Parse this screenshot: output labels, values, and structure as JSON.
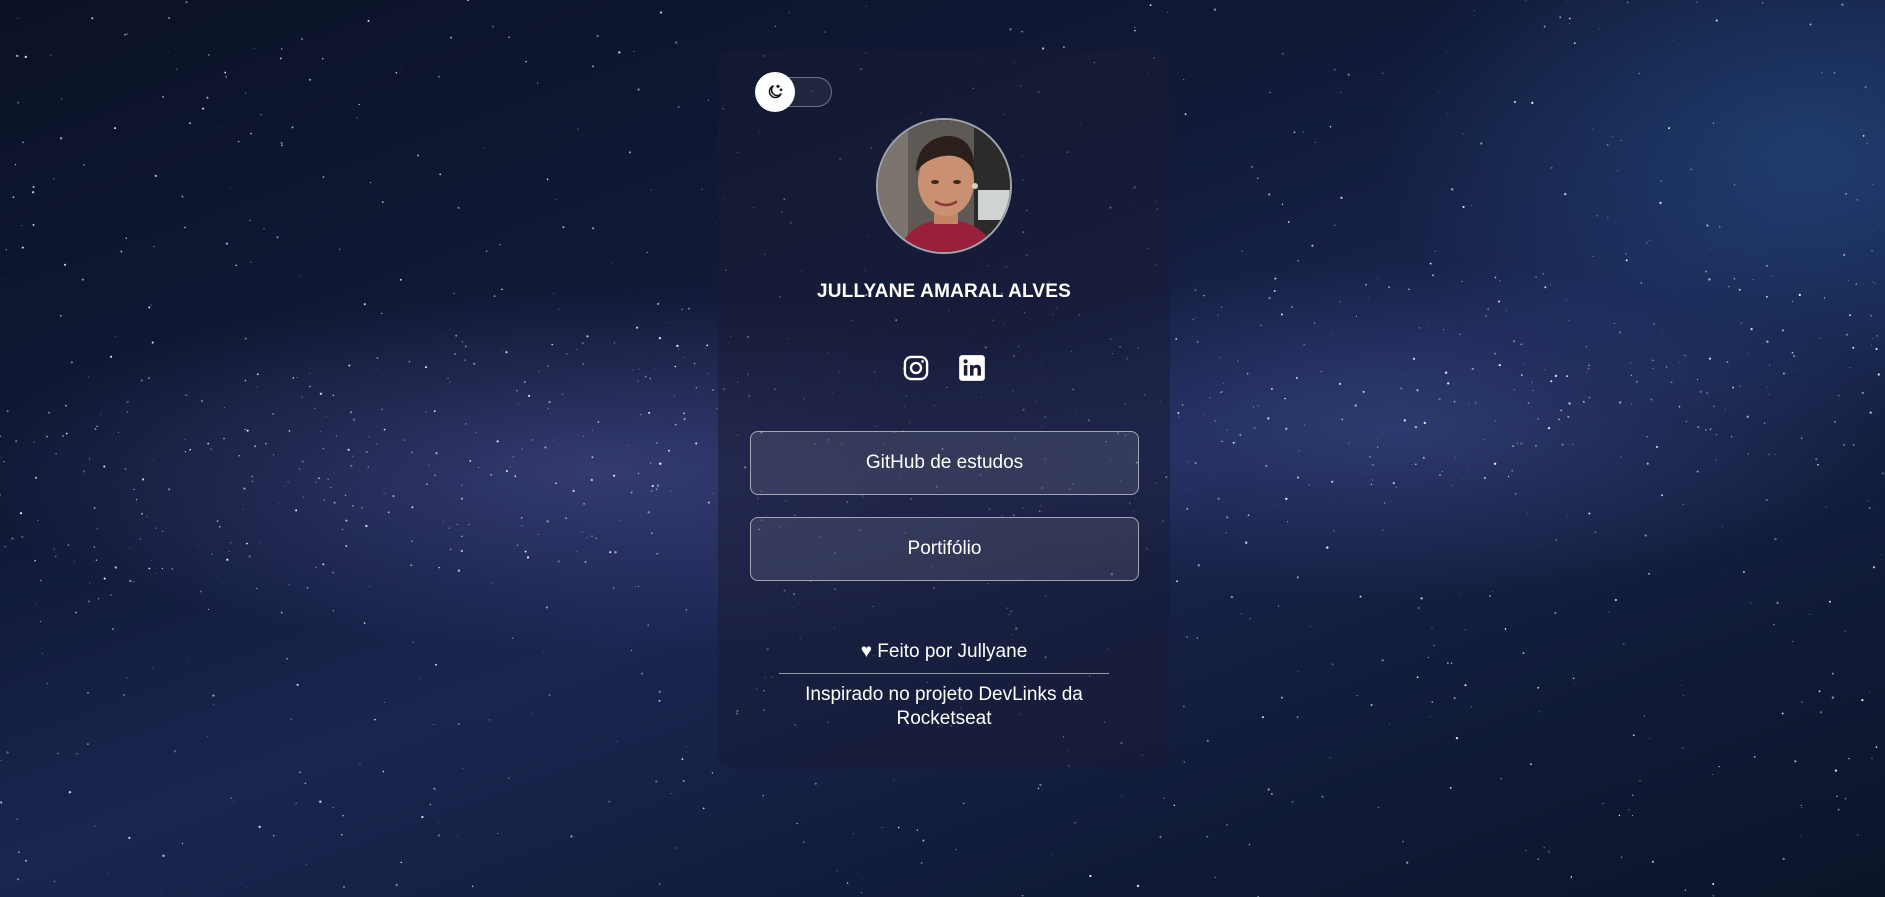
{
  "profile": {
    "name": "JULLYANE AMARAL ALVES",
    "avatar_alt": "Jullyane Amaral Alves"
  },
  "theme_toggle": {
    "icon": "moon-icon",
    "state": "dark"
  },
  "socials": [
    {
      "name": "instagram",
      "icon": "instagram-icon"
    },
    {
      "name": "linkedin",
      "icon": "linkedin-icon"
    }
  ],
  "links": [
    {
      "label": "GitHub de estudos"
    },
    {
      "label": "Portifólio"
    }
  ],
  "footer": {
    "made_by": "♥ Feito por Jullyane",
    "credit": "Inspirado no projeto DevLinks da Rocketseat"
  },
  "colors": {
    "text": "#ffffff",
    "card_background": "rgba(26,28,52,0.55)",
    "background_dark": "#0b1226",
    "background_accent": "#1a2550"
  }
}
